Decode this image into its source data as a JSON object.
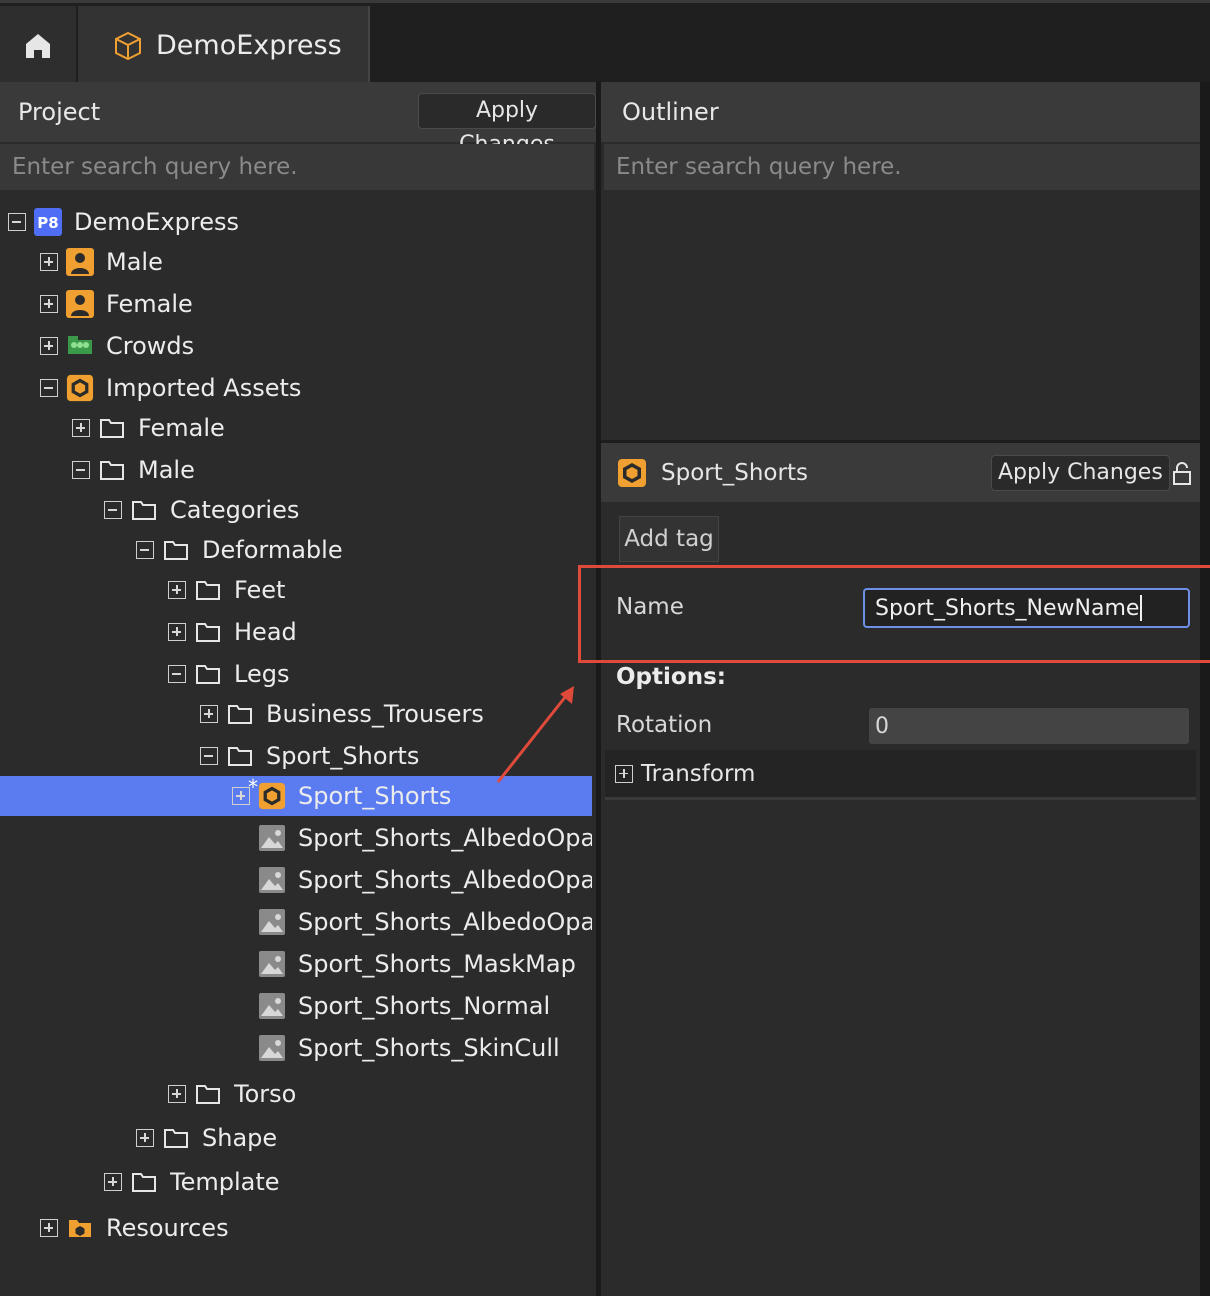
{
  "app": {
    "tab_label": "DemoExpress"
  },
  "project_panel": {
    "title": "Project",
    "apply_label": "Apply Changes",
    "search_placeholder": "Enter search query here.",
    "tree": [
      {
        "label": "DemoExpress",
        "depth": 0,
        "expander": "minus",
        "icon": "p8-logo-icon"
      },
      {
        "label": "Male",
        "depth": 1,
        "expander": "plus",
        "icon": "person-icon"
      },
      {
        "label": "Female",
        "depth": 1,
        "expander": "plus",
        "icon": "person-icon"
      },
      {
        "label": "Crowds",
        "depth": 1,
        "expander": "plus",
        "icon": "crowds-icon"
      },
      {
        "label": "Imported Assets",
        "depth": 1,
        "expander": "minus",
        "icon": "hexagon-asset-icon"
      },
      {
        "label": "Female",
        "depth": 2,
        "expander": "plus",
        "icon": "folder-icon"
      },
      {
        "label": "Male",
        "depth": 2,
        "expander": "minus",
        "icon": "folder-icon"
      },
      {
        "label": "Categories",
        "depth": 3,
        "expander": "minus",
        "icon": "folder-icon"
      },
      {
        "label": "Deformable",
        "depth": 4,
        "expander": "minus",
        "icon": "folder-icon"
      },
      {
        "label": "Feet",
        "depth": 5,
        "expander": "plus",
        "icon": "folder-icon"
      },
      {
        "label": "Head",
        "depth": 5,
        "expander": "plus",
        "icon": "folder-icon"
      },
      {
        "label": "Legs",
        "depth": 5,
        "expander": "minus",
        "icon": "folder-icon"
      },
      {
        "label": "Business_Trousers",
        "depth": 6,
        "expander": "plus",
        "icon": "folder-icon"
      },
      {
        "label": "Sport_Shorts",
        "depth": 6,
        "expander": "minus",
        "icon": "folder-icon"
      },
      {
        "label": "Sport_Shorts",
        "depth": 7,
        "expander": "plus",
        "icon": "hexagon-asset-icon",
        "selected": true,
        "modified": true
      },
      {
        "label": "Sport_Shorts_AlbedoOpac",
        "depth": 7,
        "expander": "none",
        "icon": "image-icon"
      },
      {
        "label": "Sport_Shorts_AlbedoOpac",
        "depth": 7,
        "expander": "none",
        "icon": "image-icon"
      },
      {
        "label": "Sport_Shorts_AlbedoOpac",
        "depth": 7,
        "expander": "none",
        "icon": "image-icon"
      },
      {
        "label": "Sport_Shorts_MaskMap",
        "depth": 7,
        "expander": "none",
        "icon": "image-icon"
      },
      {
        "label": "Sport_Shorts_Normal",
        "depth": 7,
        "expander": "none",
        "icon": "image-icon"
      },
      {
        "label": "Sport_Shorts_SkinCull",
        "depth": 7,
        "expander": "none",
        "icon": "image-icon"
      },
      {
        "label": "Torso",
        "depth": 5,
        "expander": "plus",
        "icon": "folder-icon"
      },
      {
        "label": "Shape",
        "depth": 4,
        "expander": "plus",
        "icon": "folder-icon"
      },
      {
        "label": "Template",
        "depth": 3,
        "expander": "plus",
        "icon": "folder-icon"
      },
      {
        "label": "Resources",
        "depth": 1,
        "expander": "plus",
        "icon": "resources-folder-icon"
      }
    ]
  },
  "outliner_panel": {
    "title": "Outliner",
    "search_placeholder": "Enter search query here."
  },
  "properties": {
    "asset_name": "Sport_Shorts",
    "apply_label": "Apply Changes",
    "add_tag_label": "Add tag",
    "name_label": "Name",
    "name_value": "Sport_Shorts_NewName",
    "options_label": "Options:",
    "rotation_label": "Rotation",
    "rotation_value": "0",
    "transform_label": "Transform"
  },
  "colors": {
    "accent_orange": "#f0a030",
    "selection_blue": "#5b7cf0",
    "highlight_red": "#e04a3a"
  }
}
